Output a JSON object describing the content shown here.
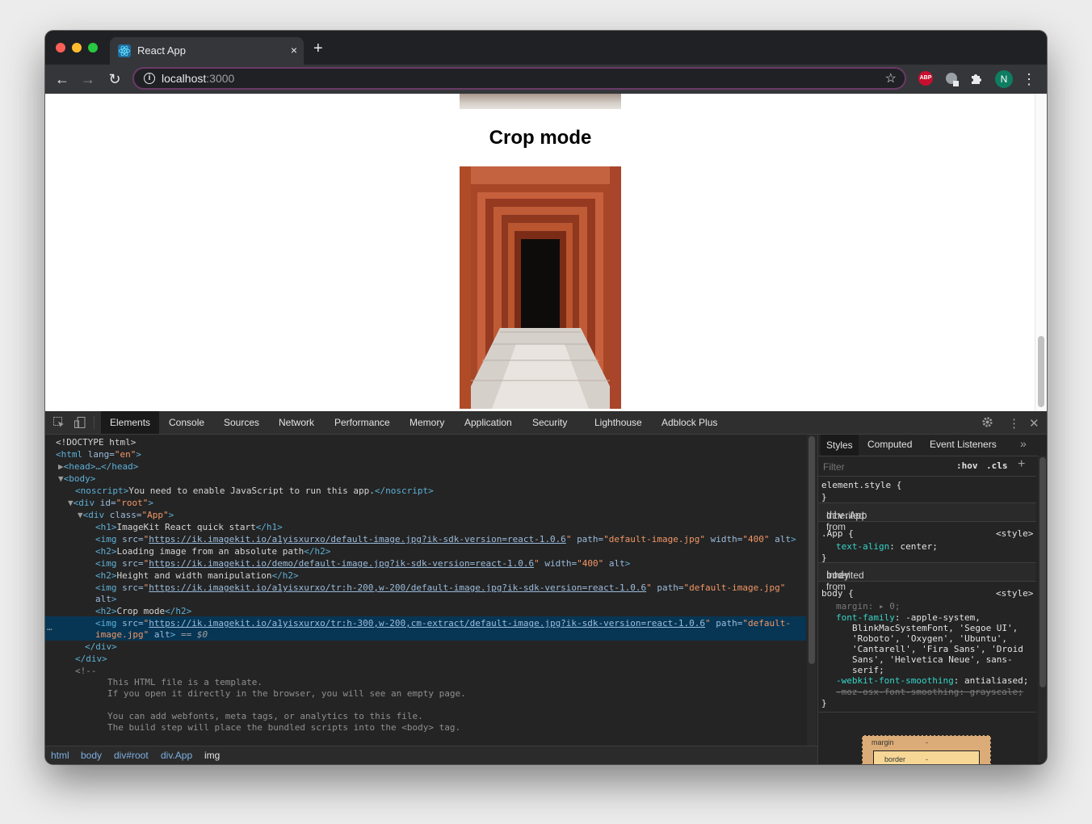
{
  "browser": {
    "tab_title": "React App",
    "tab_close": "×",
    "new_tab": "+",
    "url_host": "localhost",
    "url_port": ":3000",
    "back": "←",
    "forward": "→",
    "reload": "↻",
    "star": "☆",
    "ext_abp": "ABP",
    "avatar_initial": "N",
    "menu": "⋮"
  },
  "page": {
    "heading": "Crop mode"
  },
  "devtools": {
    "tabs": [
      "Elements",
      "Console",
      "Sources",
      "Network",
      "Performance",
      "Memory",
      "Application",
      "Security",
      "Lighthouse",
      "Adblock Plus"
    ],
    "active_tab": "Elements",
    "dom": {
      "doctype": "<!DOCTYPE html>",
      "html_open_tag": "<html",
      "html_lang_attr": "lang=",
      "html_lang_val": "\"en\"",
      "head_collapsed": "<head>…</head>",
      "body_open": "<body>",
      "noscript_open": "<noscript>",
      "noscript_text": "You need to enable JavaScript to run this app.",
      "noscript_close": "</noscript>",
      "div_root_open": "<div",
      "div_root_attr": "id=",
      "div_root_val": "\"root\"",
      "div_app_open": "<div",
      "div_app_attr": "class=",
      "div_app_val": "\"App\"",
      "h1_text": "ImageKit React quick start",
      "img1_src": "https://ik.imagekit.io/a1yisxurxo/default-image.jpg?ik-sdk-version=react-1.0.6",
      "img1_path": "\"default-image.jpg\"",
      "img1_width": "\"400\"",
      "h2a_text": "Loading image from an absolute path",
      "img2_src": "https://ik.imagekit.io/demo/default-image.jpg?ik-sdk-version=react-1.0.6",
      "img2_width": "\"400\"",
      "h2b_text": "Height and width manipulation",
      "img3_src": "https://ik.imagekit.io/a1yisxurxo/tr:h-200,w-200/default-image.jpg?ik-sdk-version=react-1.0.6",
      "img3_path": "\"default-image.jpg\"",
      "h2c_text": "Crop mode",
      "img4_src": "https://ik.imagekit.io/a1yisxurxo/tr:h-300,w-200,cm-extract/default-image.jpg?ik-sdk-version=react-1.0.6",
      "img4_path_a": "\"default-",
      "img4_path_b": "image.jpg\"",
      "selected_marker": "== $0",
      "div_close": "</div>",
      "comment_open": "<!--",
      "comment_line1": "This HTML file is a template.",
      "comment_line2": "If you open it directly in the browser, you will see an empty page.",
      "comment_line3": "You can add webfonts, meta tags, or analytics to this file.",
      "comment_line4": "The build step will place the bundled scripts into the <body> tag."
    },
    "breadcrumb": [
      "html",
      "body",
      "div#root",
      "div.App",
      "img"
    ],
    "styles": {
      "tabs": [
        "Styles",
        "Computed",
        "Event Listeners"
      ],
      "filter_placeholder": "Filter",
      "hov": ":hov",
      "cls": ".cls",
      "element_style": "element.style {",
      "close_brace": "}",
      "inherited_app": "Inherited from",
      "inherited_app_target": "div.App",
      "app_selector": ".App {",
      "app_source": "<style>",
      "app_prop": "text-align",
      "app_val": ": center;",
      "inherited_body": "Inherited from",
      "inherited_body_target": "body",
      "body_selector": "body {",
      "body_source": "<style>",
      "margin_prop": "margin",
      "margin_val": ": ▸ 0;",
      "ff_prop": "font-family",
      "ff_val1": ": -apple-system,",
      "ff_val2": "BlinkMacSystemFont, 'Segoe UI',",
      "ff_val3": "'Roboto', 'Oxygen', 'Ubuntu',",
      "ff_val4": "'Cantarell', 'Fira Sans', 'Droid",
      "ff_val5": "Sans', 'Helvetica Neue', sans-",
      "ff_val6": "serif;",
      "wfs_prop": "-webkit-font-smoothing",
      "wfs_val": ": antialiased;",
      "moz_line": "-moz-osx-font-smoothing: grayscale;",
      "box_margin": "margin",
      "box_dash": "-",
      "box_border": "border",
      "box_border_dash": "-"
    }
  }
}
